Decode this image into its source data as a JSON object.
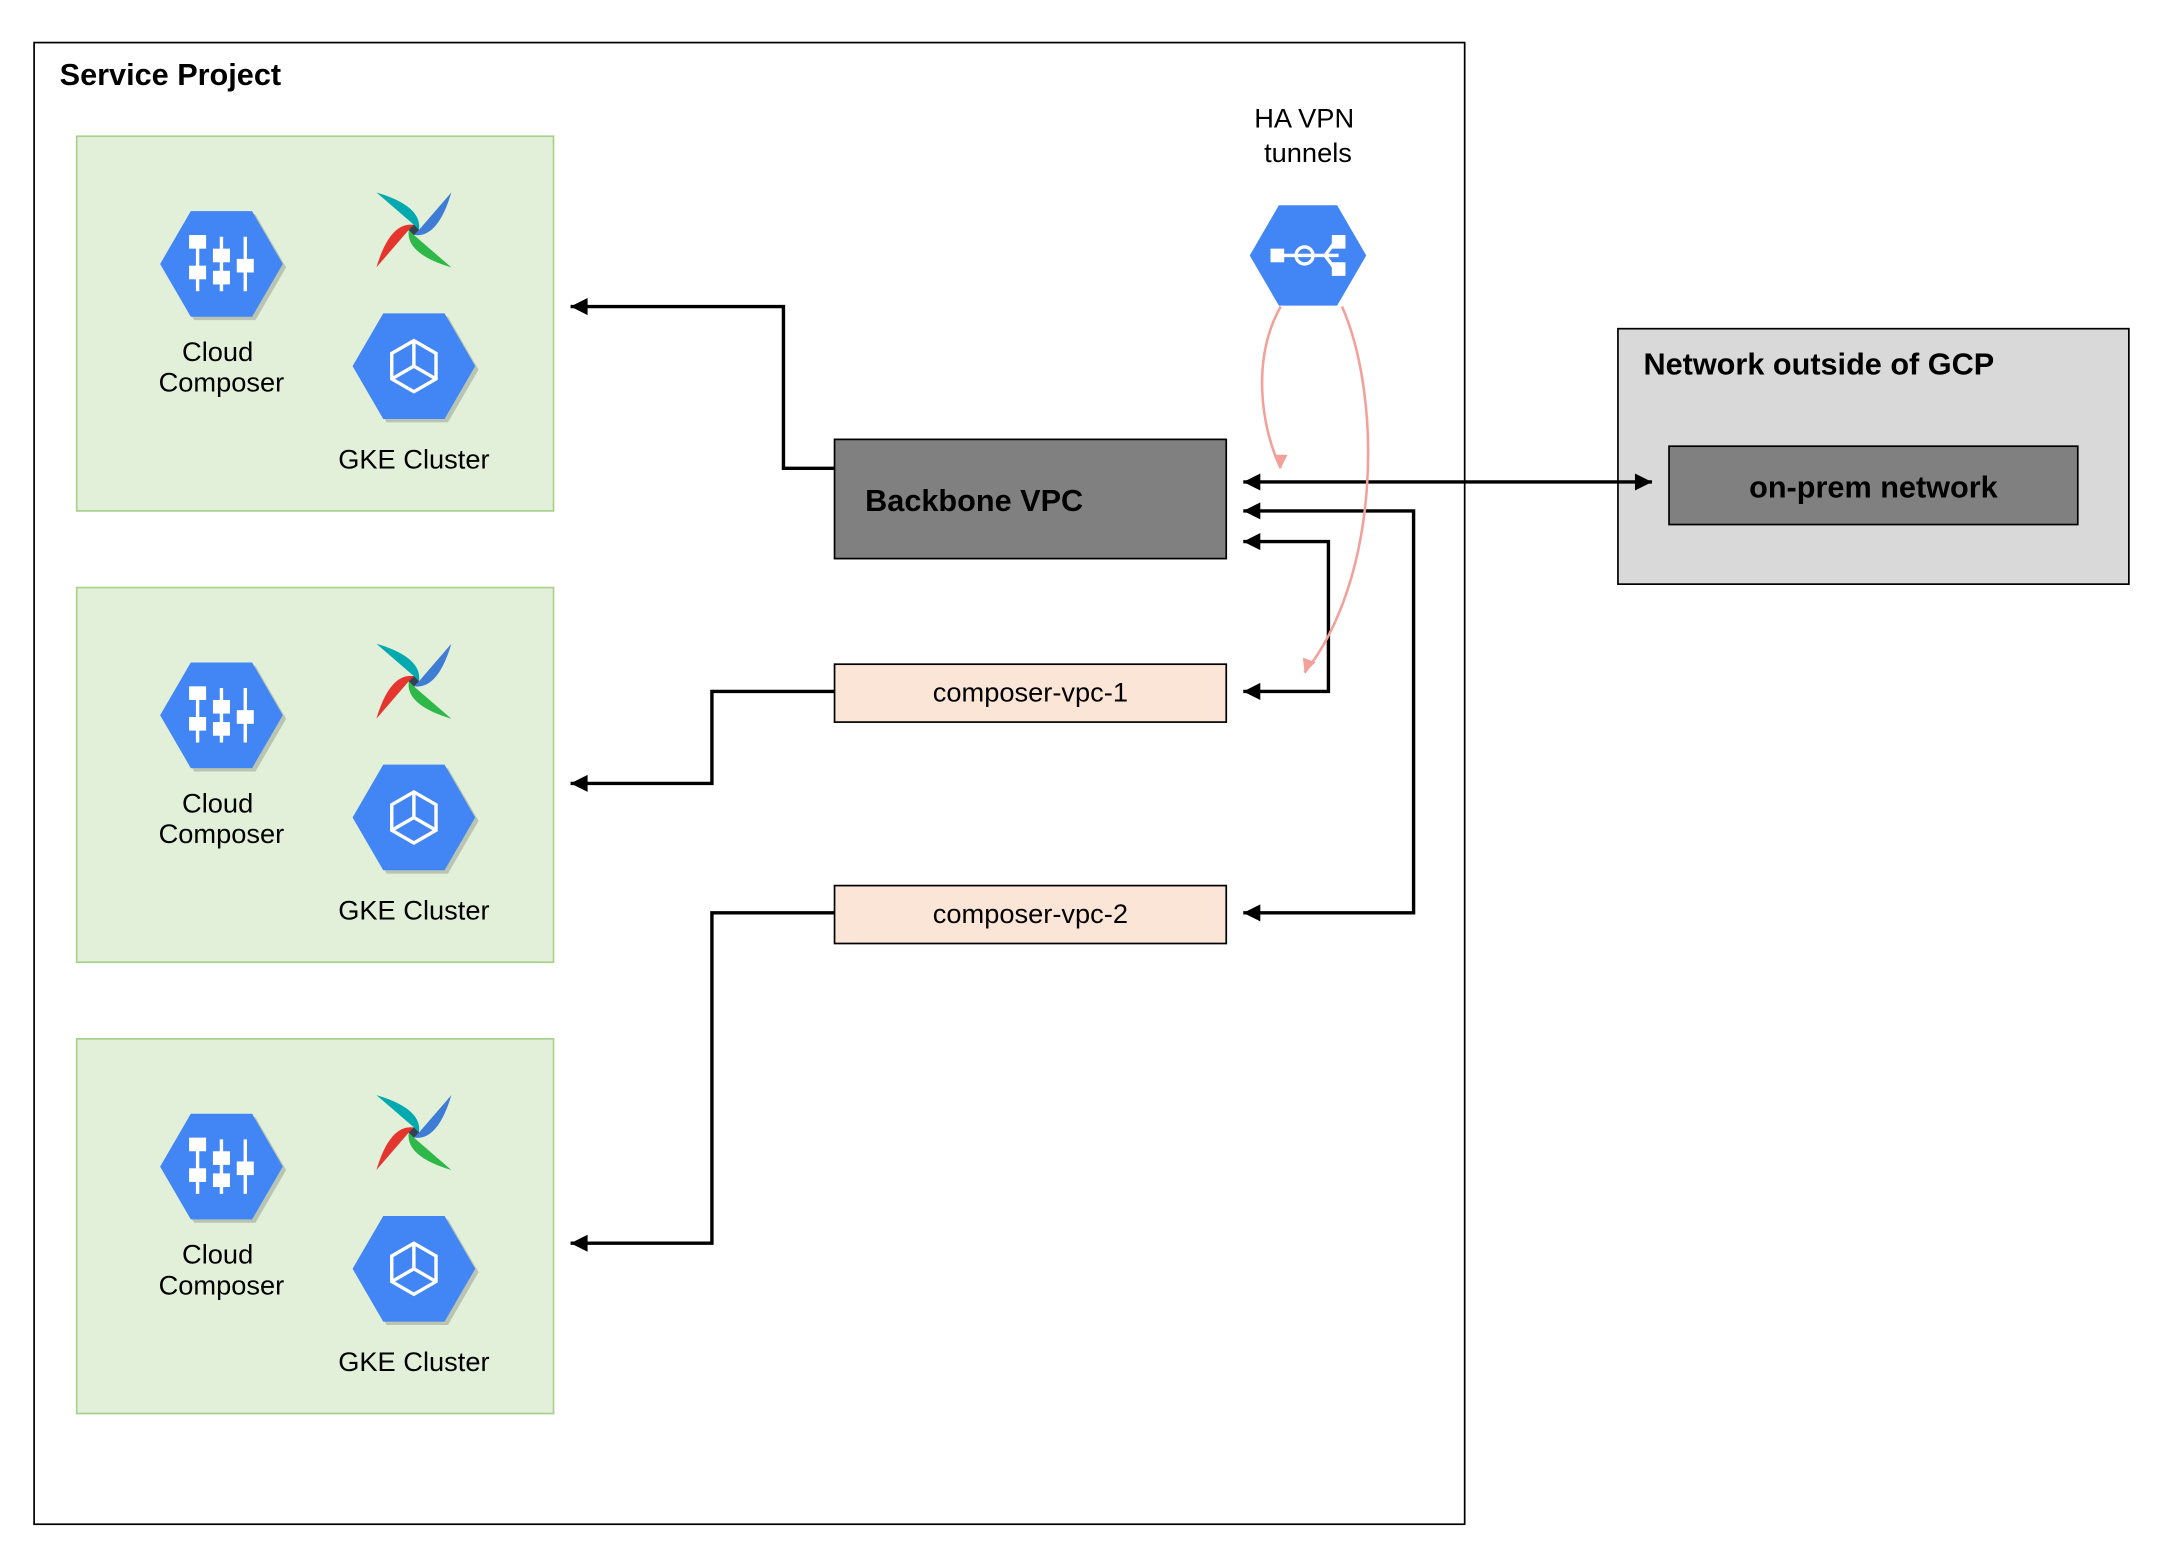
{
  "serviceProject": {
    "title": "Service Project",
    "environments": [
      {
        "composerLabel": "Cloud Composer",
        "gkeLabel": "GKE Cluster"
      },
      {
        "composerLabel": "Cloud Composer",
        "gkeLabel": "GKE Cluster"
      },
      {
        "composerLabel": "Cloud Composer",
        "gkeLabel": "GKE Cluster"
      }
    ]
  },
  "backboneLabel": "Backbone VPC",
  "composerVpc1Label": "composer-vpc-1",
  "composerVpc2Label": "composer-vpc-2",
  "haVpnLabel1": "HA VPN",
  "haVpnLabel2": "tunnels",
  "outsideLabel": "Network outside of GCP",
  "onPremLabel": "on-prem network",
  "icons": {
    "composer": "cloud-composer-icon",
    "gke": "gke-icon",
    "airflow": "airflow-pinwheel-icon",
    "vpn": "vpn-hub-icon"
  },
  "colors": {
    "gcpBlue": "#4285F4",
    "envFill": "#E2F0D9",
    "envStroke": "#A9D18E",
    "backboneFill": "#808080",
    "vpcFill": "#FBE5D6",
    "outsideFill": "#D9D9D9",
    "pink": "#F4A09A"
  }
}
